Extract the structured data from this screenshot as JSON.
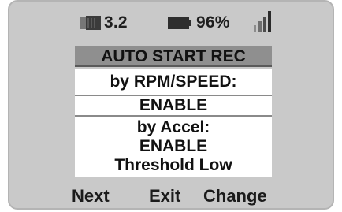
{
  "status_bar": {
    "memory_value": "3.2",
    "battery_percent": "96%",
    "battery_level": 0.96,
    "signal_bars": 4,
    "icons": [
      "memory-card-icon",
      "battery-icon",
      "signal-icon"
    ]
  },
  "menu": {
    "title": "AUTO START REC",
    "line1": "by RPM/SPEED:",
    "line2": "ENABLE",
    "line3": "by Accel:",
    "line4": "ENABLE",
    "line5": "Threshold Low"
  },
  "softkeys": {
    "left": "Next",
    "middle": "Exit",
    "right": "Change"
  },
  "colors": {
    "device_background": "#c9c9c9",
    "title_bar": "#8f8f8f",
    "screen_white": "#ffffff",
    "text": "#111111"
  }
}
